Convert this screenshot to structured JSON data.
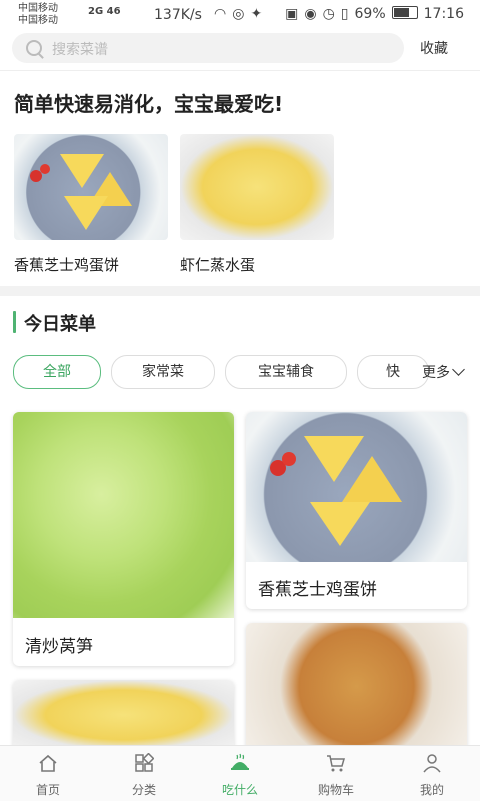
{
  "status": {
    "carrier1": "中国移动",
    "carrier2": "中国移动",
    "signal": "2G 46",
    "speed": "137K/s",
    "battery": "69%",
    "time": "17:16"
  },
  "search": {
    "placeholder": "搜索菜谱",
    "fav_label": "收藏"
  },
  "recommend": {
    "title": "简单快速易消化，宝宝最爱吃!",
    "items": [
      {
        "name": "香蕉芝士鸡蛋饼"
      },
      {
        "name": "虾仁蒸水蛋"
      }
    ]
  },
  "today": {
    "title": "今日菜单",
    "chips": [
      "全部",
      "家常菜",
      "宝宝辅食",
      "快"
    ],
    "more": "更多",
    "cards": [
      {
        "name": "清炒莴笋"
      },
      {
        "name": "香蕉芝士鸡蛋饼"
      }
    ]
  },
  "nav": {
    "items": [
      {
        "label": "首页",
        "icon": "home-icon"
      },
      {
        "label": "分类",
        "icon": "grid-icon"
      },
      {
        "label": "吃什么",
        "icon": "dish-icon"
      },
      {
        "label": "购物车",
        "icon": "cart-icon"
      },
      {
        "label": "我的",
        "icon": "person-icon"
      }
    ],
    "active_color": "#43ad66"
  },
  "colors": {
    "accent": "#4fb372",
    "divider": "#f2f2f2"
  }
}
